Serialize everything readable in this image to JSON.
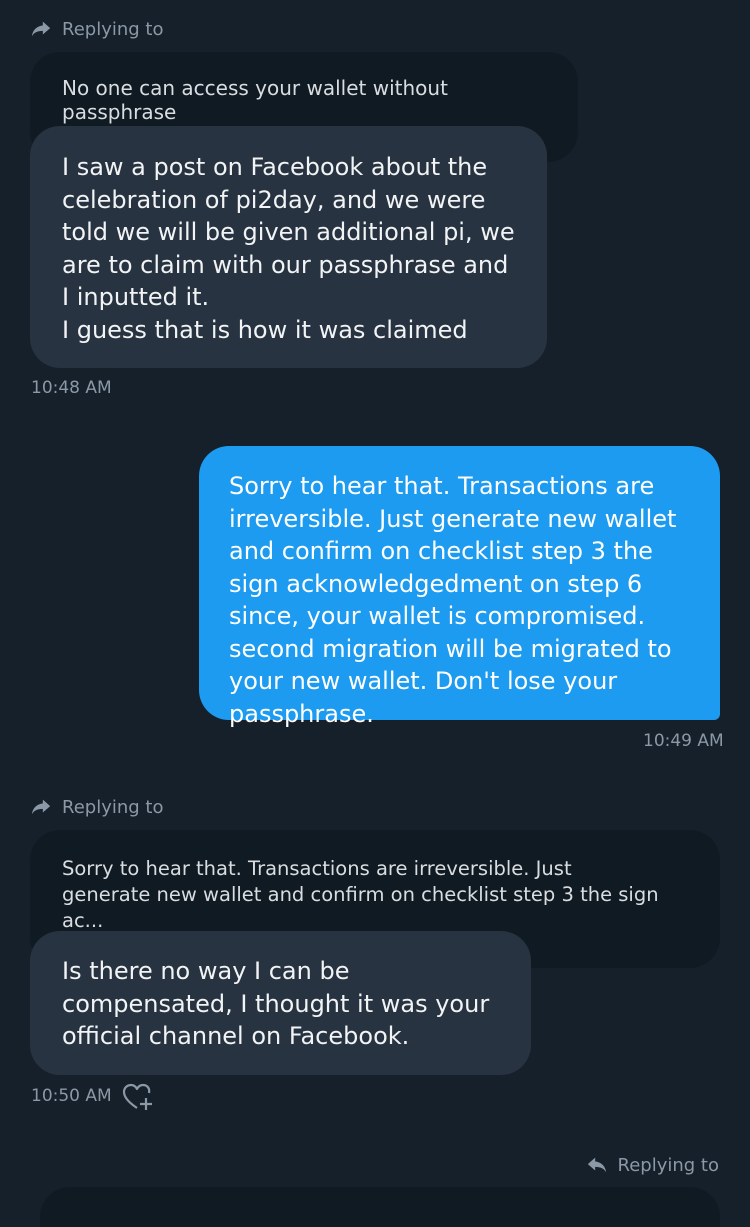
{
  "messages": {
    "reply_label": "Replying to",
    "first": {
      "quote": "No one can access your wallet without passphrase",
      "text": "I saw a post on Facebook about the celebration of pi2day, and we were told we will be given additional pi, we are to claim with our passphrase and I inputted it.\nI guess that is how it was claimed",
      "time": "10:48 AM"
    },
    "second": {
      "text": "Sorry to hear that. Transactions are irreversible. Just generate new wallet and confirm on checklist step 3 the sign acknowledgedment on step 6 since, your wallet is compromised. second migration will be migrated to your new wallet. Don't lose your passphrase.",
      "time": "10:49 AM"
    },
    "third": {
      "quote": "Sorry to hear that. Transactions are irreversible. Just\ngenerate new wallet and confirm on checklist step 3 the sign ac...",
      "text": "Is there no way I can be compensated, I thought it was your official channel on Facebook.",
      "time": "10:50 AM"
    },
    "fourth": {
      "reply_label": "Replying to"
    }
  },
  "icons": {
    "reply": "reply-arrow-icon",
    "react": "heart-plus-icon"
  },
  "colors": {
    "background": "#15202b",
    "incoming_bubble": "#273340",
    "outgoing_bubble": "#1d9bf0",
    "quote_bubble": "#101a23",
    "muted_text": "#8b98a5"
  }
}
